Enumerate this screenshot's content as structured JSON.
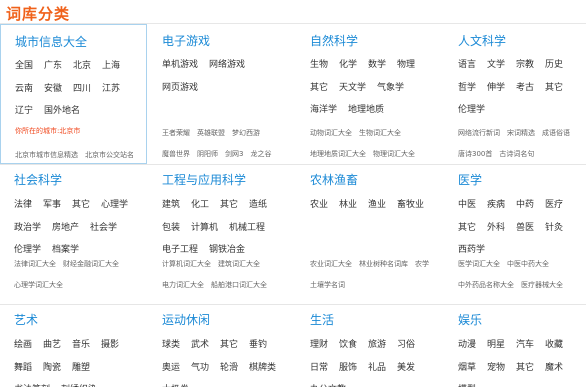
{
  "header": {
    "title": "词库分类"
  },
  "rows": [
    [
      {
        "title": "城市信息大全",
        "words": [
          "全国",
          "广东",
          "北京",
          "上海",
          "云南",
          "安徽",
          "四川",
          "江苏",
          "辽宁",
          "国外地名"
        ],
        "location": "你所在的城市:北京市",
        "sub": [
          "北京市城市信息精选",
          "北京市公交站名"
        ]
      },
      {
        "title": "电子游戏",
        "words": [
          "单机游戏",
          "网络游戏",
          "网页游戏"
        ],
        "sub": [
          "王者荣耀",
          "英雄联盟",
          "梦幻西游",
          "魔兽世界",
          "阴阳师",
          "剑网3",
          "龙之谷"
        ]
      },
      {
        "title": "自然科学",
        "words": [
          "生物",
          "化学",
          "数学",
          "物理",
          "其它",
          "天文学",
          "气象学",
          "海洋学",
          "地理地质"
        ],
        "sub": [
          "动物词汇大全",
          "生物词汇大全",
          "地理地质词汇大全",
          "物理词汇大全"
        ]
      },
      {
        "title": "人文科学",
        "words": [
          "语言",
          "文学",
          "宗教",
          "历史",
          "哲学",
          "伸学",
          "考古",
          "其它",
          "伦理学"
        ],
        "sub": [
          "网络流行新词",
          "宋词精选",
          "成语俗语",
          "唐诗300首",
          "古诗词名句"
        ]
      }
    ],
    [
      {
        "title": "社会科学",
        "words": [
          "法律",
          "军事",
          "其它",
          "心理学",
          "政治学",
          "房地产",
          "社会学",
          "伦理学",
          "档案学"
        ],
        "sub": [
          "法律词汇大全",
          "财经金融词汇大全",
          "心理学词汇大全"
        ]
      },
      {
        "title": "工程与应用科学",
        "words": [
          "建筑",
          "化工",
          "其它",
          "造纸",
          "包装",
          "计算机",
          "机械工程",
          "电子工程",
          "钢铁冶金"
        ],
        "sub": [
          "计算机词汇大全",
          "建筑词汇大全",
          "电力词汇大全",
          "船舶港口词汇大全"
        ]
      },
      {
        "title": "农林渔畜",
        "words": [
          "农业",
          "林业",
          "渔业",
          "畜牧业"
        ],
        "sub": [
          "农业词汇大全",
          "林业树种名词库",
          "农学",
          "土壤学名词"
        ]
      },
      {
        "title": "医学",
        "words": [
          "中医",
          "疾病",
          "中药",
          "医疗",
          "其它",
          "外科",
          "兽医",
          "针灸",
          "西药学"
        ],
        "sub": [
          "医学词汇大全",
          "中医中药大全",
          "中外药品名称大全",
          "医疗器械大全"
        ]
      }
    ],
    [
      {
        "title": "艺术",
        "words": [
          "绘画",
          "曲艺",
          "音乐",
          "摄影",
          "舞蹈",
          "陶瓷",
          "雕塑",
          "书法篆刻",
          "刺绣织染"
        ]
      },
      {
        "title": "运动休闲",
        "words": [
          "球类",
          "武术",
          "其它",
          "垂钓",
          "奥运",
          "气功",
          "轮滑",
          "棋牌类",
          "太极拳"
        ]
      },
      {
        "title": "生活",
        "words": [
          "理财",
          "饮食",
          "旅游",
          "习俗",
          "日常",
          "服饰",
          "礼品",
          "美发",
          "办公文教"
        ]
      },
      {
        "title": "娱乐",
        "words": [
          "动漫",
          "明星",
          "汽车",
          "收藏",
          "烟草",
          "宠物",
          "其它",
          "魔术",
          "模型"
        ]
      }
    ]
  ]
}
